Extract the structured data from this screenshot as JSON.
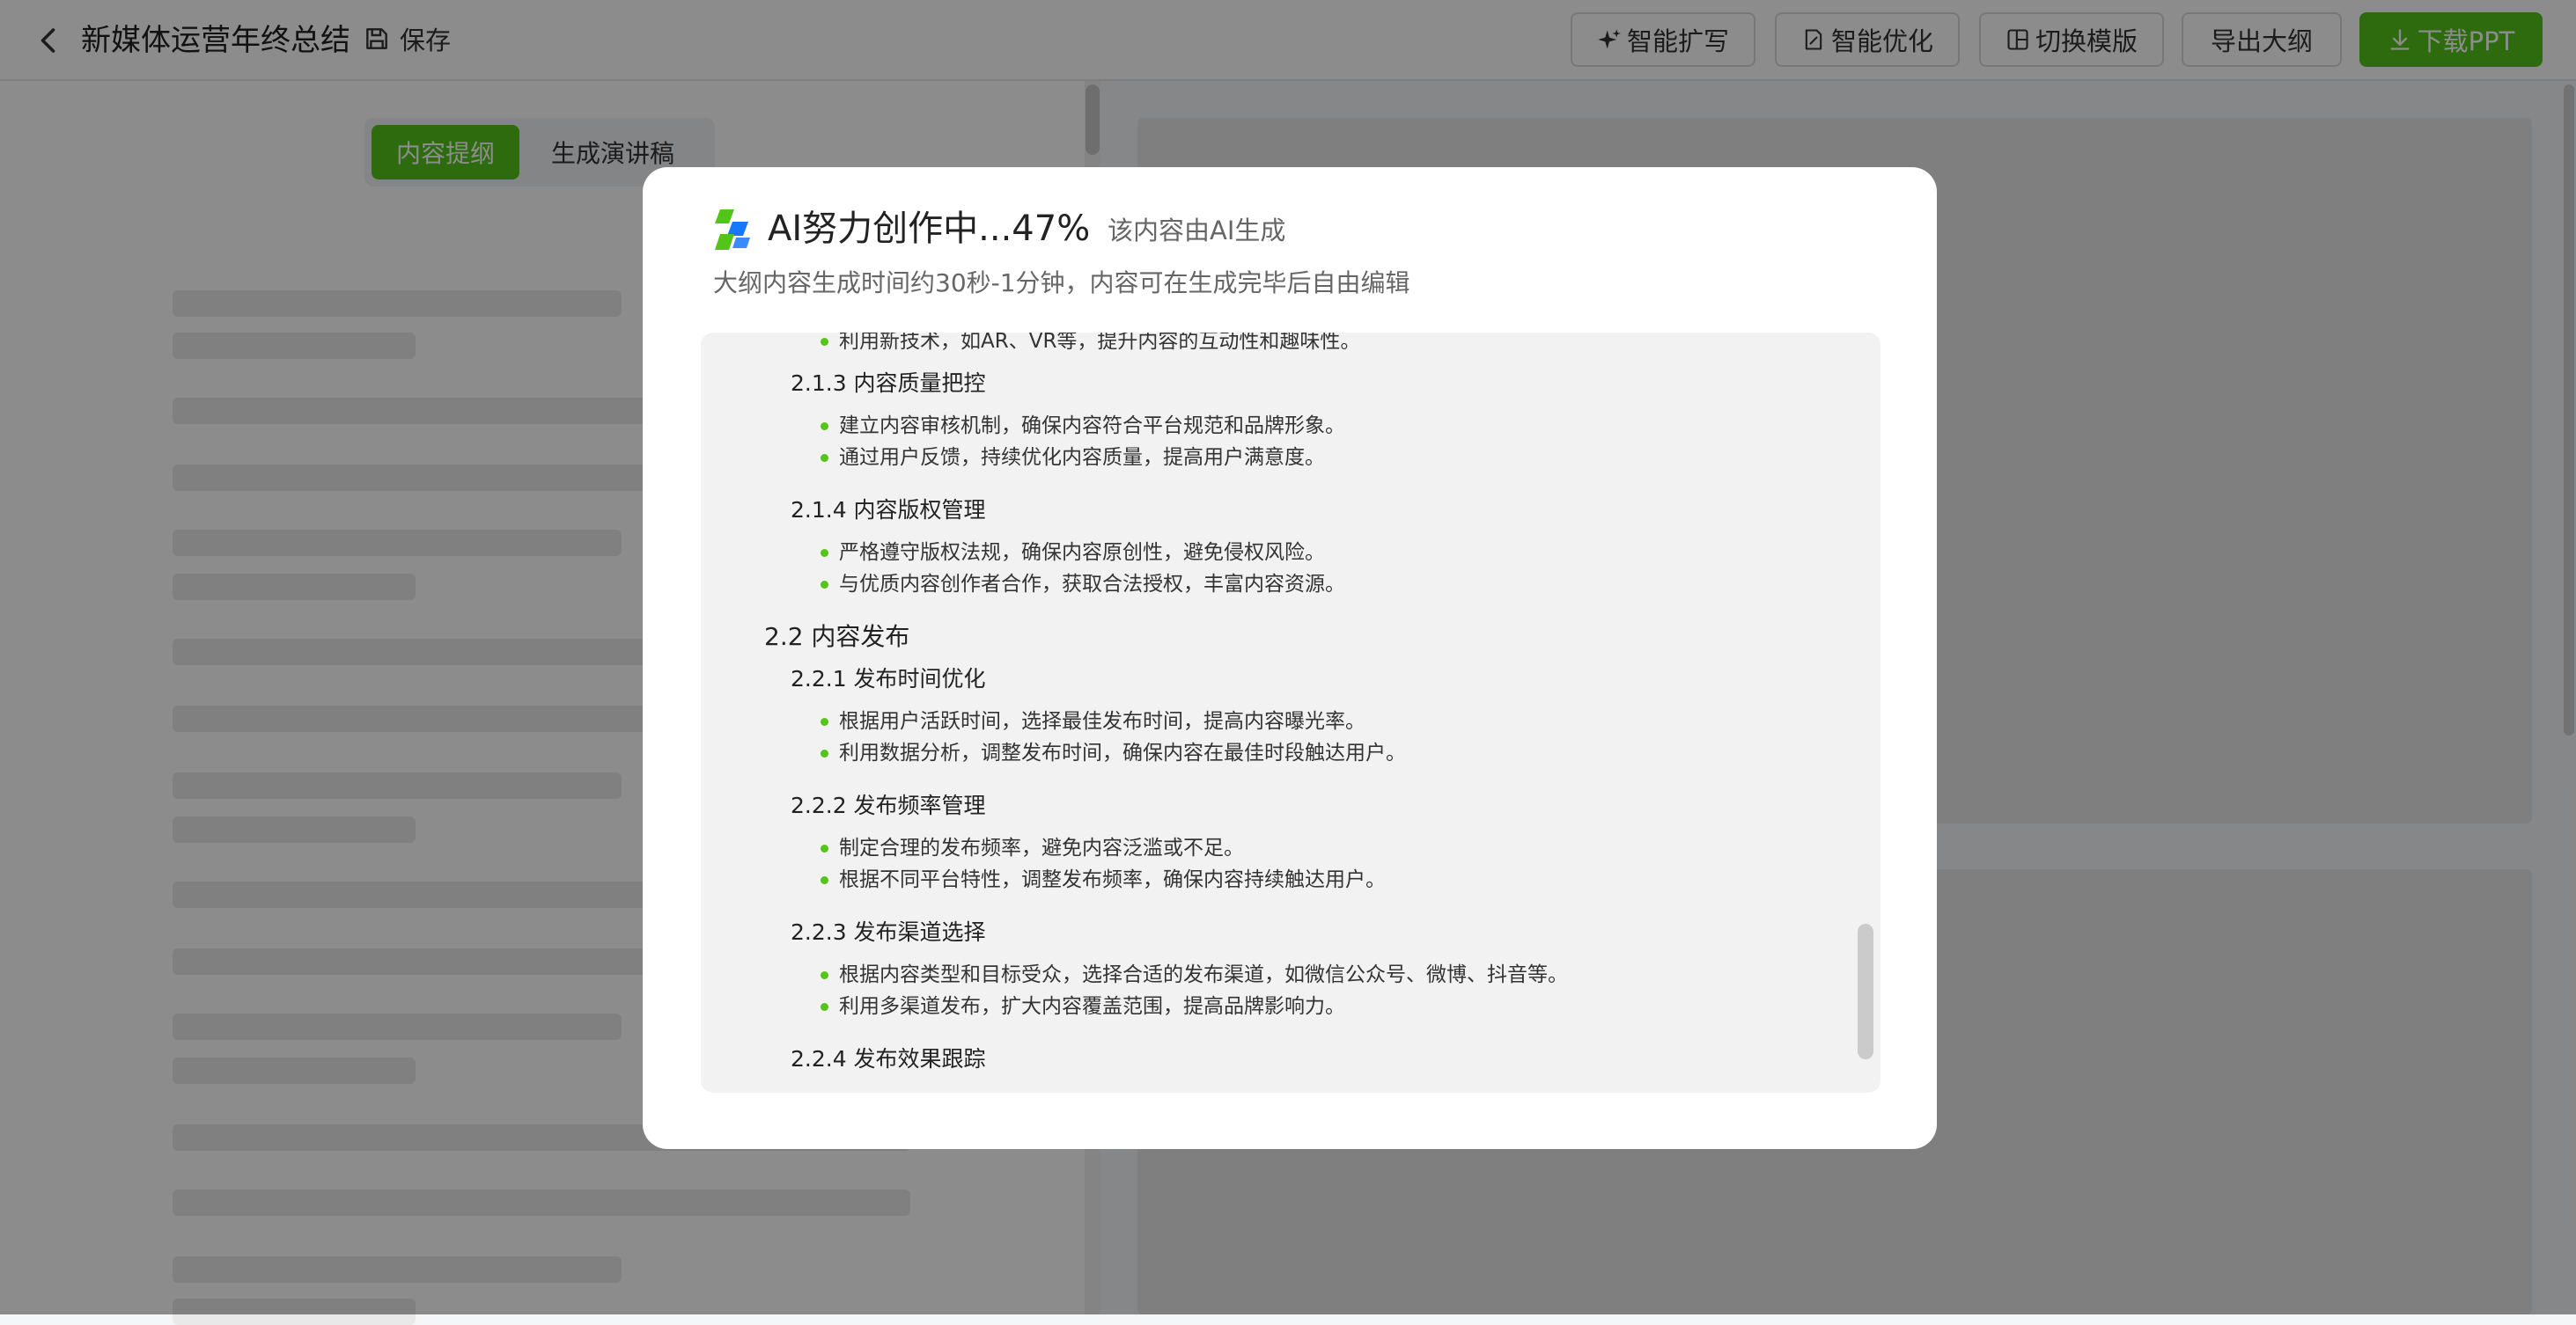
{
  "colors": {
    "accent": "#52c41a",
    "mask": "rgba(0,0,0,0.45)"
  },
  "header": {
    "back_icon": "chevron-left-icon",
    "title": "新媒体运营年终总结",
    "save_label": "保存",
    "buttons": {
      "expand": "智能扩写",
      "optimize": "智能优化",
      "switch_template": "切换模版",
      "export_outline": "导出大纲",
      "download": "下载PPT"
    }
  },
  "left_tabs": {
    "outline": "内容提纲",
    "speech": "生成演讲稿"
  },
  "modal": {
    "title": "AI努力创作中...47%",
    "progress_percent": 47,
    "tag": "该内容由AI生成",
    "subtitle": "大纲内容生成时间约30秒-1分钟，内容可在生成完毕后自由编辑",
    "outline": {
      "b0": "利用新技术，如AR、VR等，提升内容的互动性和趣味性。",
      "h213": "2.1.3 内容质量把控",
      "b1": "建立内容审核机制，确保内容符合平台规范和品牌形象。",
      "b2": "通过用户反馈，持续优化内容质量，提高用户满意度。",
      "h214": "2.1.4 内容版权管理",
      "b3": "严格遵守版权法规，确保内容原创性，避免侵权风险。",
      "b4": "与优质内容创作者合作，获取合法授权，丰富内容资源。",
      "h22": "2.2 内容发布",
      "h221": "2.2.1 发布时间优化",
      "b5": "根据用户活跃时间，选择最佳发布时间，提高内容曝光率。",
      "b6": "利用数据分析，调整发布时间，确保内容在最佳时段触达用户。",
      "h222": "2.2.2 发布频率管理",
      "b7": "制定合理的发布频率，避免内容泛滥或不足。",
      "b8": "根据不同平台特性，调整发布频率，确保内容持续触达用户。",
      "h223": "2.2.3 发布渠道选择",
      "b9": "根据内容类型和目标受众，选择合适的发布渠道，如微信公众号、微博、抖音等。",
      "b10": "利用多渠道发布，扩大内容覆盖范围，提高品牌影响力。",
      "h224": "2.2.4 发布效果跟踪"
    }
  }
}
